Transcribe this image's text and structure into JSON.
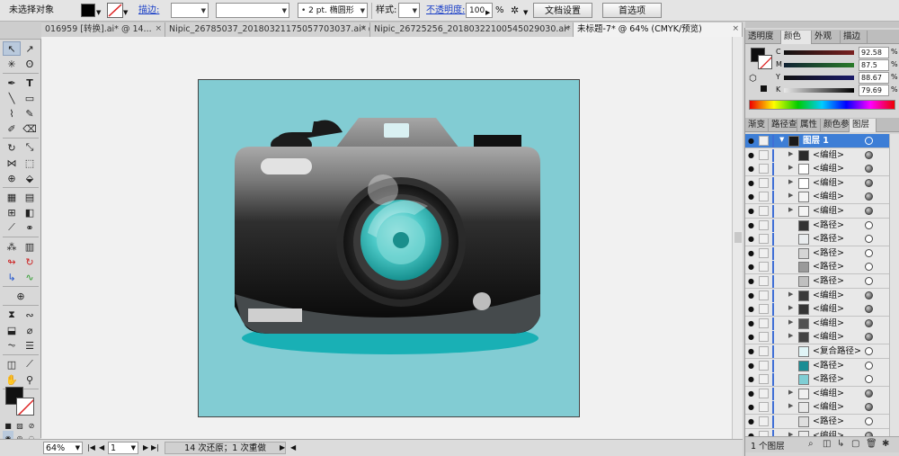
{
  "control_bar": {
    "selection_status": "未选择对象",
    "stroke_label": "描边:",
    "brush_size": "2 pt.",
    "brush_shape": "椭圆形",
    "style_label": "样式:",
    "opacity_label": "不透明度:",
    "opacity_value": "100",
    "opacity_unit": "%",
    "doc_setup_button": "文档设置",
    "preferences_button": "首选项"
  },
  "tabs": [
    {
      "label": "016959 [转换].ai* @ 14...",
      "active": false
    },
    {
      "label": "Nipic_26785037_20180321175057703037.ai* @ ...",
      "active": false
    },
    {
      "label": "Nipic_26725256_20180322100545029030.ai* @ ...",
      "active": false
    },
    {
      "label": "未标题-7* @ 64% (CMYK/预览)",
      "active": true
    }
  ],
  "status_bar": {
    "zoom": "64%",
    "artboard_index": "1",
    "history_text": "14 次还原；1 次重做"
  },
  "color_panel": {
    "tabs": [
      "透明度",
      "颜色",
      "外观",
      "描边"
    ],
    "active_tab": "颜色",
    "channels": [
      {
        "label": "C",
        "value": "92.58",
        "color": "#00aeef"
      },
      {
        "label": "M",
        "value": "87.5",
        "color": "#ec008c"
      },
      {
        "label": "Y",
        "value": "88.67",
        "color": "#fff200"
      },
      {
        "label": "K",
        "value": "79.69",
        "color": "#231f20"
      }
    ],
    "percent_sign": "%",
    "current_color": "#0f0f10"
  },
  "layers_panel": {
    "tabs": [
      "渐变",
      "路径查",
      "属性",
      "颜色参",
      "图层"
    ],
    "active_tab": "图层",
    "layers": [
      {
        "name": "图层 1",
        "top": true,
        "has_arrow": true,
        "thumb": "#1a1a1a",
        "target_filled": false
      },
      {
        "name": "<编组>",
        "has_arrow": true,
        "thumb": "#2a2a2a",
        "target_filled": true
      },
      {
        "name": "<编组>",
        "has_arrow": true,
        "thumb": "#ffffff",
        "target_filled": true
      },
      {
        "name": "<编组>",
        "has_arrow": true,
        "thumb": "#ffffff",
        "target_filled": true
      },
      {
        "name": "<编组>",
        "has_arrow": true,
        "thumb": "#f4f4f4",
        "target_filled": true
      },
      {
        "name": "<编组>",
        "has_arrow": true,
        "thumb": "#f4f4f4",
        "target_filled": true
      },
      {
        "name": "<路径>",
        "has_arrow": false,
        "thumb": "#333333",
        "target_filled": false
      },
      {
        "name": "<路径>",
        "has_arrow": false,
        "thumb": "#e9ecee",
        "target_filled": false
      },
      {
        "name": "<路径>",
        "has_arrow": false,
        "thumb": "#d5d5d5",
        "target_filled": false
      },
      {
        "name": "<路径>",
        "has_arrow": false,
        "thumb": "#9a9a9a",
        "target_filled": false
      },
      {
        "name": "<路径>",
        "has_arrow": false,
        "thumb": "#bfbfbf",
        "target_filled": false
      },
      {
        "name": "<编组>",
        "has_arrow": true,
        "thumb": "#3a3a3a",
        "target_filled": true
      },
      {
        "name": "<编组>",
        "has_arrow": true,
        "thumb": "#333333",
        "target_filled": true
      },
      {
        "name": "<编组>",
        "has_arrow": true,
        "thumb": "#505050",
        "target_filled": true
      },
      {
        "name": "<编组>",
        "has_arrow": true,
        "thumb": "#444444",
        "target_filled": true
      },
      {
        "name": "<复合路径>",
        "has_arrow": false,
        "thumb": "#e0f4f6",
        "target_filled": false
      },
      {
        "name": "<路径>",
        "has_arrow": false,
        "thumb": "#1a8d94",
        "target_filled": false
      },
      {
        "name": "<路径>",
        "has_arrow": false,
        "thumb": "#80ced4",
        "target_filled": false
      },
      {
        "name": "<编组>",
        "has_arrow": true,
        "thumb": "#f0f0f0",
        "target_filled": true
      },
      {
        "name": "<编组>",
        "has_arrow": true,
        "thumb": "#e8e8e8",
        "target_filled": true
      },
      {
        "name": "<路径>",
        "has_arrow": false,
        "thumb": "#dedede",
        "target_filled": false
      },
      {
        "name": "<编组>",
        "has_arrow": true,
        "thumb": "#eaeaea",
        "target_filled": true
      }
    ],
    "footer_text": "1 个图层"
  }
}
